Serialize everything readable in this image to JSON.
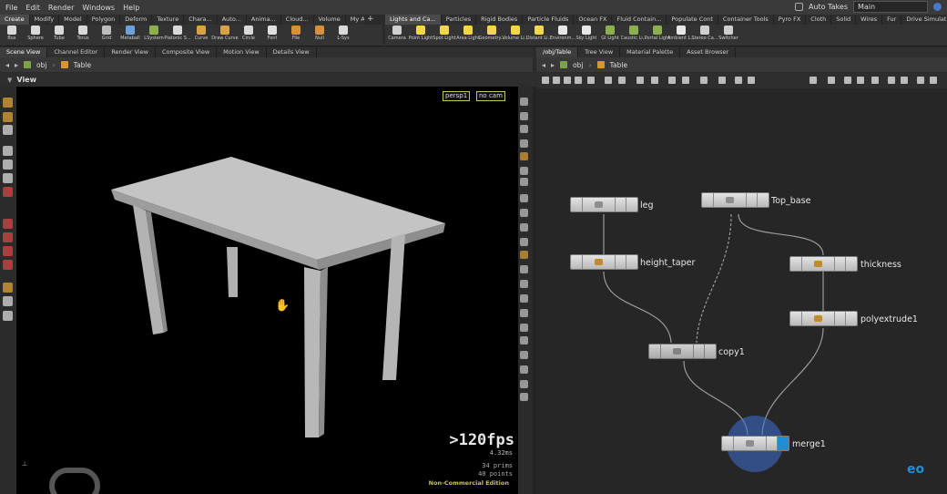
{
  "menu": {
    "items": [
      "File",
      "Edit",
      "Render",
      "Windows",
      "Help"
    ],
    "auto_takes": "Auto Takes",
    "desktop": "Main"
  },
  "shelf_tabs_left": [
    {
      "label": "Create",
      "active": true
    },
    {
      "label": "Modify"
    },
    {
      "label": "Model"
    },
    {
      "label": "Polygon"
    },
    {
      "label": "Deform"
    },
    {
      "label": "Texture"
    },
    {
      "label": "Chara..."
    },
    {
      "label": "Auto..."
    },
    {
      "label": "Anima..."
    },
    {
      "label": "Cloud..."
    },
    {
      "label": "Volume"
    },
    {
      "label": "My As..."
    }
  ],
  "shelf_tabs_right": [
    {
      "label": "Lights and Ca...",
      "active": true
    },
    {
      "label": "Particles"
    },
    {
      "label": "Rigid Bodies"
    },
    {
      "label": "Particle Fluids"
    },
    {
      "label": "Ocean FX"
    },
    {
      "label": "Fluid Contain..."
    },
    {
      "label": "Populate Cont"
    },
    {
      "label": "Container Tools"
    },
    {
      "label": "Pyro FX"
    },
    {
      "label": "Cloth"
    },
    {
      "label": "Solid"
    },
    {
      "label": "Wires"
    },
    {
      "label": "Fur"
    },
    {
      "label": "Drive Simulat..."
    }
  ],
  "tools_left": [
    {
      "label": "Box",
      "color": "#d9d9d9",
      "icon": "box-icon"
    },
    {
      "label": "Sphere",
      "color": "#d9d9d9",
      "icon": "sphere-icon"
    },
    {
      "label": "Tube",
      "color": "#d9d9d9",
      "icon": "tube-icon"
    },
    {
      "label": "Torus",
      "color": "#d9d9d9",
      "icon": "torus-icon"
    },
    {
      "label": "Grid",
      "color": "#bdbdbd",
      "icon": "grid-icon"
    },
    {
      "label": "Metaball",
      "color": "#6fa1d8",
      "icon": "metaball-icon"
    },
    {
      "label": "LSystem",
      "color": "#8bb04f",
      "icon": "lsystem-icon"
    },
    {
      "label": "Platonic S...",
      "color": "#d9d9d9",
      "icon": "platonic-icon"
    },
    {
      "label": "Curve",
      "color": "#d8a24a",
      "icon": "curve-icon"
    },
    {
      "label": "Draw Curve",
      "color": "#d8a24a",
      "icon": "draw-curve-icon"
    },
    {
      "label": "Circle",
      "color": "#d9d9d9",
      "icon": "circle-icon"
    },
    {
      "label": "Font",
      "color": "#e0e0e0",
      "icon": "font-icon"
    },
    {
      "label": "File",
      "color": "#d9903a",
      "icon": "file-icon"
    },
    {
      "label": "Null",
      "color": "#d9903a",
      "icon": "null-icon"
    },
    {
      "label": "L-Sys",
      "color": "#d9d9d9",
      "icon": "lsys-icon"
    }
  ],
  "tools_right": [
    {
      "label": "Camera",
      "color": "#cfcfcf",
      "icon": "camera-icon"
    },
    {
      "label": "Point Light",
      "color": "#f2d64b",
      "icon": "point-light-icon"
    },
    {
      "label": "Spot Light",
      "color": "#f2d64b",
      "icon": "spot-light-icon"
    },
    {
      "label": "Area Light",
      "color": "#f2d64b",
      "icon": "area-light-icon"
    },
    {
      "label": "Geometry...",
      "color": "#f2d64b",
      "icon": "geometry-light-icon"
    },
    {
      "label": "Volume Li...",
      "color": "#f2d64b",
      "icon": "volume-light-icon"
    },
    {
      "label": "Distant Li...",
      "color": "#f2d64b",
      "icon": "distant-light-icon"
    },
    {
      "label": "Environm...",
      "color": "#e7e7e7",
      "icon": "environment-light-icon"
    },
    {
      "label": "Sky Light",
      "color": "#e7e7e7",
      "icon": "sky-light-icon"
    },
    {
      "label": "GI Light",
      "color": "#8bb04f",
      "icon": "gi-light-icon"
    },
    {
      "label": "Caustic Li...",
      "color": "#8bb04f",
      "icon": "caustic-light-icon"
    },
    {
      "label": "Portal Light",
      "color": "#8bb04f",
      "icon": "portal-light-icon"
    },
    {
      "label": "Ambient L...",
      "color": "#e7e7e7",
      "icon": "ambient-light-icon"
    },
    {
      "label": "Stereo Ca...",
      "color": "#cfcfcf",
      "icon": "stereo-camera-icon"
    },
    {
      "label": "Switcher",
      "color": "#cfcfcf",
      "icon": "switcher-icon"
    }
  ],
  "pane_tabs_left": [
    {
      "label": "Scene View",
      "active": true
    },
    {
      "label": "Channel Editor"
    },
    {
      "label": "Render View"
    },
    {
      "label": "Composite View"
    },
    {
      "label": "Motion View"
    },
    {
      "label": "Details View"
    }
  ],
  "pane_tabs_right": [
    {
      "label": "/obj/Table",
      "active": true
    },
    {
      "label": "Tree View"
    },
    {
      "label": "Material Palette"
    },
    {
      "label": "Asset Browser"
    }
  ],
  "scene_path": {
    "context": "obj",
    "node": "Table"
  },
  "network_path": {
    "context": "obj",
    "node": "Table"
  },
  "viewport": {
    "title": "View",
    "camera_menu": "persp1",
    "cam_menu": "no cam",
    "fps": ">120fps",
    "ms": "4.32ms",
    "prims": "34  prims",
    "points": "40 points",
    "edition": "Non-Commercial Edition"
  },
  "nodes": [
    {
      "name": "leg",
      "type": "geo",
      "name_key": "leg"
    },
    {
      "name": "Top_base",
      "type": "geo",
      "name_key": "top_base"
    },
    {
      "name": "height_taper",
      "type": "sop"
    },
    {
      "name": "thickness",
      "type": "sop"
    },
    {
      "name": "polyextrude1",
      "type": "sop"
    },
    {
      "name": "copy1",
      "type": "copy"
    },
    {
      "name": "merge1",
      "type": "merge",
      "flag_color": "#1e8fd6",
      "highlight": "#3c6fd4"
    }
  ],
  "colors": {
    "viewport_bg": "#000000",
    "ui_bg": "#2b2b2b",
    "network_bg": "#262626",
    "accent": "#1e8fd6",
    "table": "#bdbdbd"
  }
}
